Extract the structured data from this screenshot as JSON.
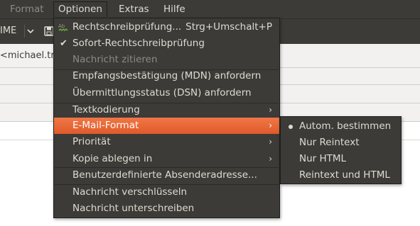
{
  "menubar": {
    "items": [
      {
        "label": "Format",
        "state": "dim"
      },
      {
        "label": "Optionen",
        "state": "open"
      },
      {
        "label": "Extras",
        "state": "normal"
      },
      {
        "label": "Hilfe",
        "state": "normal"
      }
    ]
  },
  "toolbar": {
    "partial_label": "IME",
    "arrow_icon": "chevron-down-icon",
    "save_icon": "save-icon"
  },
  "compose": {
    "address_partial": "<michael.tre"
  },
  "optionen_menu": {
    "items": [
      {
        "label": "Rechtschreibprüfung...",
        "accel": "Strg+Umschalt+P",
        "icon": "spellcheck-icon"
      },
      {
        "label": "Sofort-Rechtschreibprüfung",
        "checked": true
      },
      {
        "label": "Nachricht zitieren",
        "disabled": true
      },
      {
        "label": "Empfangsbestätigung (MDN) anfordern"
      },
      {
        "label": "Übermittlungsstatus (DSN) anfordern"
      },
      {
        "label": "Textkodierung",
        "submenu": true
      },
      {
        "label": "E-Mail-Format",
        "submenu": true,
        "highlighted": true
      },
      {
        "label": "Priorität",
        "submenu": true
      },
      {
        "label": "Kopie ablegen in",
        "submenu": true
      },
      {
        "label": "Benutzerdefinierte Absenderadresse..."
      },
      {
        "label": "Nachricht verschlüsseln"
      },
      {
        "label": "Nachricht unterschreiben"
      }
    ],
    "submenu_arrow": "›"
  },
  "format_submenu": {
    "items": [
      {
        "label": "Autom. bestimmen",
        "selected": true
      },
      {
        "label": "Nur Reintext"
      },
      {
        "label": "Nur HTML"
      },
      {
        "label": "Reintext und HTML"
      }
    ]
  },
  "colors": {
    "menu_bg": "#3c3b37",
    "menu_text": "#dfdbd2",
    "highlight": "#e8663a",
    "disabled_text": "#8d8a83"
  }
}
